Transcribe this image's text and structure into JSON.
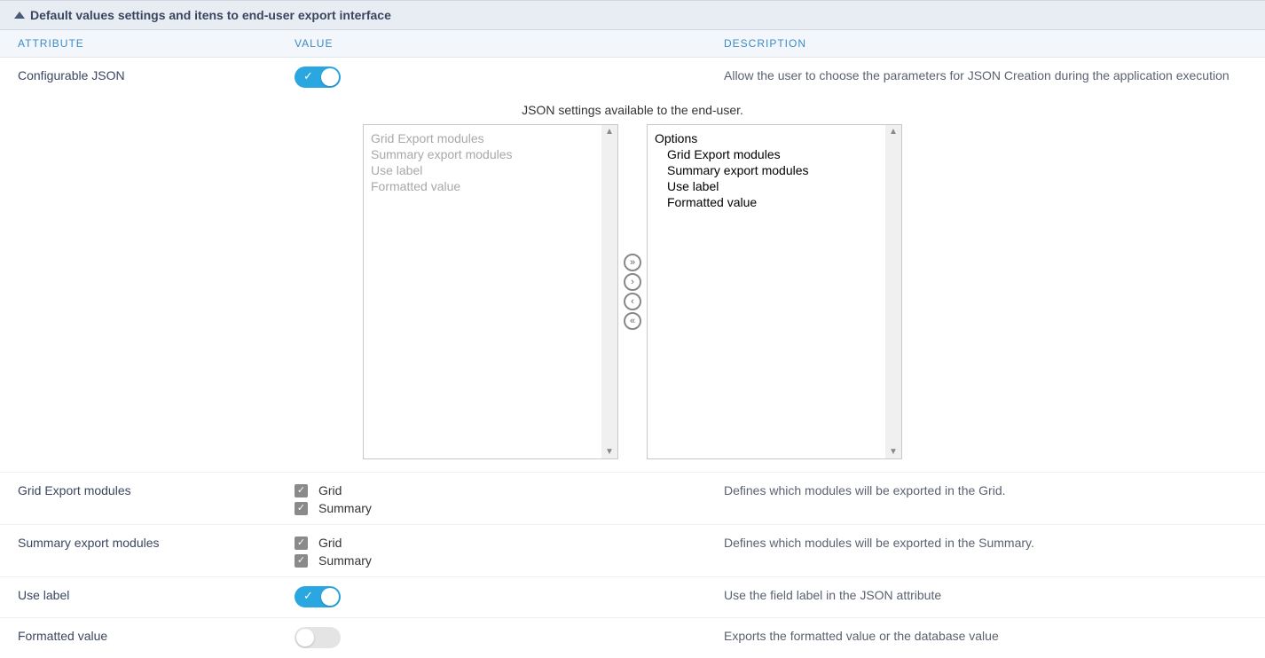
{
  "section": {
    "title": "Default values settings and itens to end-user export interface"
  },
  "headers": {
    "attribute": "ATTRIBUTE",
    "value": "VALUE",
    "description": "DESCRIPTION"
  },
  "rows": {
    "configurable_json": {
      "label": "Configurable JSON",
      "desc": "Allow the user to choose the parameters for JSON Creation during the application execution"
    },
    "grid_export_modules": {
      "label": "Grid Export modules",
      "desc": "Defines which modules will be exported in the Grid.",
      "options": {
        "grid": "Grid",
        "summary": "Summary"
      }
    },
    "summary_export_modules": {
      "label": "Summary export modules",
      "desc": "Defines which modules will be exported in the Summary.",
      "options": {
        "grid": "Grid",
        "summary": "Summary"
      }
    },
    "use_label": {
      "label": "Use label",
      "desc": "Use the field label in the JSON attribute"
    },
    "formatted_value": {
      "label": "Formatted value",
      "desc": "Exports the formatted value or the database value"
    }
  },
  "dual_list": {
    "caption": "JSON settings available to the end-user.",
    "left": [
      "Grid Export modules",
      "Summary export modules",
      "Use label",
      "Formatted value"
    ],
    "right_group": "Options",
    "right_children": [
      "Grid Export modules",
      "Summary export modules",
      "Use label",
      "Formatted value"
    ]
  }
}
